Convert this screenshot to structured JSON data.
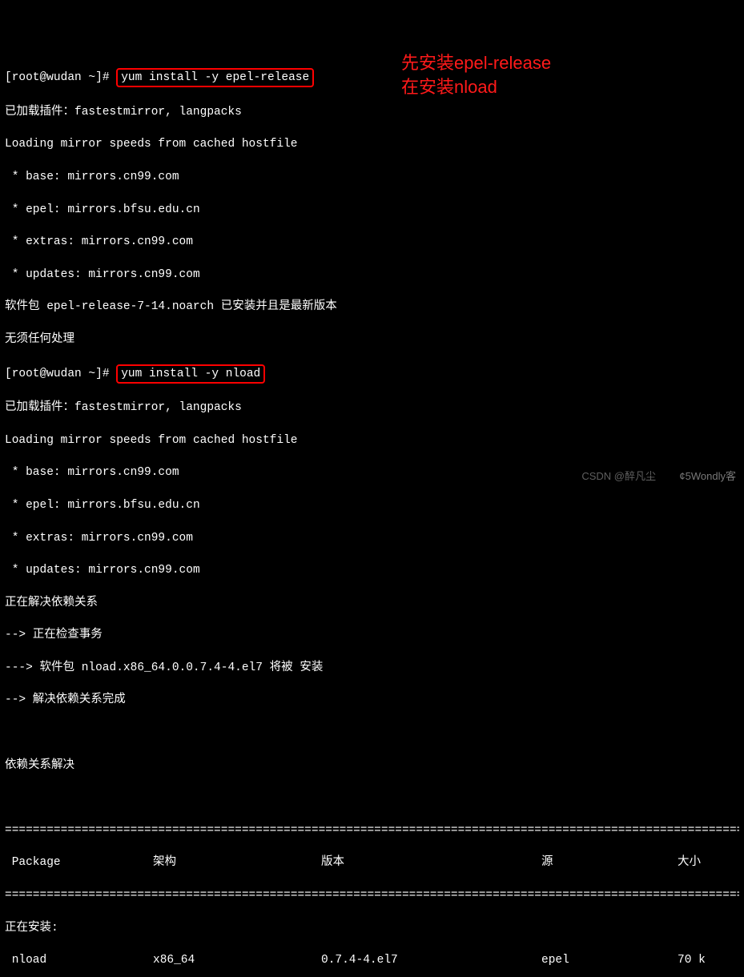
{
  "prompt1_prefix": "[root@wudan ~]# ",
  "cmd1": "yum install -y epel-release",
  "out1_l1": "已加载插件：fastestmirror, langpacks",
  "out1_l2": "Loading mirror speeds from cached hostfile",
  "out1_l3": " * base: mirrors.cn99.com",
  "out1_l4": " * epel: mirrors.bfsu.edu.cn",
  "out1_l5": " * extras: mirrors.cn99.com",
  "out1_l6": " * updates: mirrors.cn99.com",
  "out1_l7": "软件包 epel-release-7-14.noarch 已安装并且是最新版本",
  "out1_l8": "无须任何处理",
  "prompt2_prefix": "[root@wudan ~]# ",
  "cmd2": "yum install -y nload",
  "out2_l1": "已加载插件：fastestmirror, langpacks",
  "out2_l2": "Loading mirror speeds from cached hostfile",
  "out2_l3": " * base: mirrors.cn99.com",
  "out2_l4": " * epel: mirrors.bfsu.edu.cn",
  "out2_l5": " * extras: mirrors.cn99.com",
  "out2_l6": " * updates: mirrors.cn99.com",
  "out2_l7": "正在解决依赖关系",
  "out2_l8": "--> 正在检查事务",
  "out2_l9": "---> 软件包 nload.x86_64.0.0.7.4-4.el7 将被 安装",
  "out2_l10": "--> 解决依赖关系完成",
  "blank": " ",
  "out2_l11": "依赖关系解决",
  "divider": "=================================================================================================================",
  "hdr_pkg": " Package",
  "hdr_arch": "架构",
  "hdr_ver": "版本",
  "hdr_repo": "源",
  "hdr_size": "大小",
  "installing": "正在安装:",
  "row_pkg": " nload",
  "row_arch": "x86_64",
  "row_ver": "0.7.4-4.el7",
  "row_repo": "epel",
  "row_size": "70 k",
  "anno1": "先安装epel-release",
  "anno2": "在安装nload",
  "wm1": "CSDN @醉凡尘",
  "wm2": "¢5Wondly客"
}
